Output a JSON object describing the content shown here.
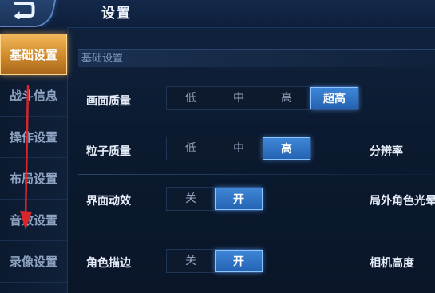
{
  "header": {
    "title": "设置",
    "back_icon": "back-arrow-icon"
  },
  "sidebar": {
    "items": [
      {
        "label": "基础设置",
        "active": true
      },
      {
        "label": "战斗信息",
        "active": false
      },
      {
        "label": "操作设置",
        "active": false
      },
      {
        "label": "布局设置",
        "active": false
      },
      {
        "label": "音效设置",
        "active": false
      },
      {
        "label": "录像设置",
        "active": false
      }
    ]
  },
  "section": {
    "title": "基础设置"
  },
  "settings": {
    "image_quality": {
      "label": "画面质量",
      "options": [
        "低",
        "中",
        "高",
        "超高"
      ],
      "selected": "超高"
    },
    "particle_quality": {
      "label": "粒子质量",
      "options": [
        "低",
        "中",
        "高"
      ],
      "selected": "高"
    },
    "ui_effects": {
      "label": "界面动效",
      "options": [
        "关",
        "开"
      ],
      "selected": "开"
    },
    "character_outline": {
      "label": "角色描边",
      "options": [
        "关",
        "开"
      ],
      "selected": "开"
    }
  },
  "right_column": {
    "resolution": "分辨率",
    "outside_light": "局外角色光晕",
    "camera_height": "相机高度"
  },
  "colors": {
    "active_tab": "#e3a145",
    "selected_option": "#2f74c8",
    "annotation_arrow": "#d9262c"
  }
}
